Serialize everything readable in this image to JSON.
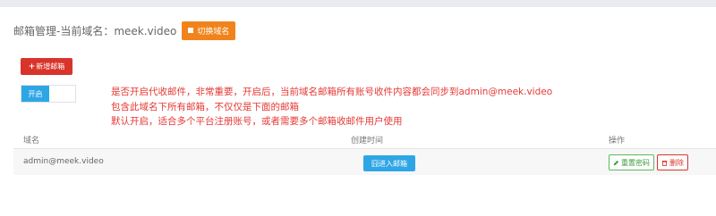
{
  "header": {
    "title": "邮箱管理-当前域名：meek.video",
    "switch_domain_label": "切换域名"
  },
  "toolbar": {
    "add_mailbox_label": "新增邮箱"
  },
  "forwarding_toggle": {
    "label": "开启",
    "state": "on"
  },
  "notice": {
    "lines": [
      "是否开启代收邮件，非常重要，开启后，当前域名邮箱所有账号收件内容都会同步到admin@meek.video",
      "包含此域名下所有邮箱，不仅仅是下面的邮箱",
      "默认开启，适合多个平台注册账号，或者需要多个邮箱收邮件用户使用"
    ]
  },
  "table": {
    "columns": [
      "域名",
      "创建时间",
      "操作"
    ],
    "rows": [
      {
        "address": "admin@meek.video",
        "enter_label": "囧进入邮箱",
        "reset_label": "重置密码",
        "delete_label": "删除"
      }
    ]
  },
  "icons": {
    "add": "plus-icon",
    "reset": "pencil-icon",
    "delete": "trash-icon",
    "switch": "square-icon"
  },
  "colors": {
    "orange": "#f0841c",
    "red": "#d9342b",
    "blue": "#2ea6e6",
    "green": "#5cb85c",
    "notice": "#e53935"
  }
}
